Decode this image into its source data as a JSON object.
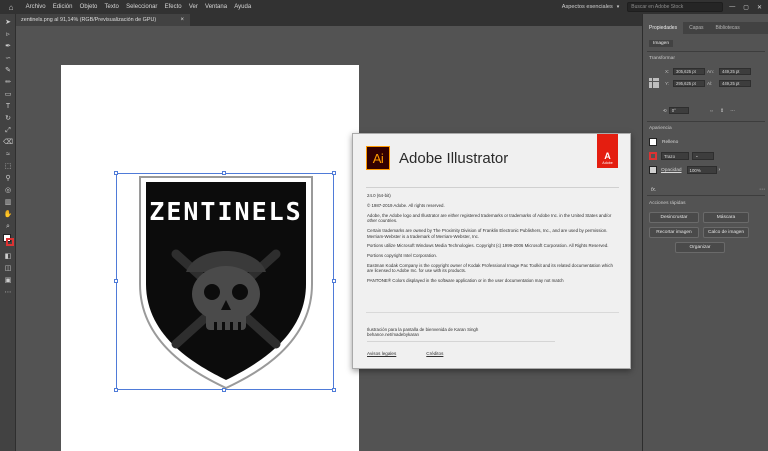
{
  "menubar": {
    "items": [
      "Archivo",
      "Edición",
      "Objeto",
      "Texto",
      "Seleccionar",
      "Efecto",
      "Ver",
      "Ventana",
      "Ayuda"
    ],
    "workspace": "Aspectos esenciales",
    "stock_search_placeholder": "Buscar en Adobe Stock",
    "window_controls": [
      "—",
      "▢",
      "✕"
    ]
  },
  "document_tab": {
    "title": "zentinels.png al 91,14% (RGB/Previsualización de GPU)",
    "close": "×"
  },
  "artwork": {
    "text": "ZENTINELS"
  },
  "about": {
    "logo": "Ai",
    "product_name": "Adobe Illustrator",
    "adobe_badge": {
      "letter": "A",
      "label": "Adobe"
    },
    "version": "24.0 (64-bit)",
    "copyright": "© 1987-2019 Adobe. All rights reserved.",
    "p1": "Adobe, the Adobe logo and Illustrator are either registered trademarks or trademarks of Adobe Inc. in the United States and/or other countries.",
    "p2": "Certain trademarks are owned by The Proximity Division of Franklin Electronic Publishers, Inc., and are used by permission. Merriam-Webster is a trademark of Merriam-Webster, Inc.",
    "p3": "Portions utilize Microsoft Windows Media Technologies. Copyright (c) 1999-2006 Microsoft Corporation. All Rights Reserved.",
    "p4": "Portions copyright Intel Corporation.",
    "p5": "Eastman Kodak Company is the copyright owner of Kodak Professional Image Pac Toolkit and its related documentation which are licensed to Adobe Inc. for use with its products.",
    "p6": "PANTONE® Colors displayed in the software application or in the user documentation may not match",
    "credit_line1": "Ilustración para la pantalla de bienvenida de Karan Singh",
    "credit_line2": "behance.net/madebykaran",
    "link_legal": "Avisos legales",
    "link_credits": "Créditos"
  },
  "panel": {
    "tabs": [
      "Propiedades",
      "Capas",
      "Bibliotecas"
    ],
    "context": "Imagen",
    "transform": {
      "title": "Transformar",
      "x_label": "X:",
      "x_value": "305,625 pt",
      "y_label": "Y:",
      "y_value": "295,625 pt",
      "w_label": "An:",
      "w_value": "449,25 pt",
      "h_label": "Al:",
      "h_value": "449,25 pt",
      "rotation": "0°"
    },
    "appearance": {
      "title": "Apariencia",
      "fill_label": "Relleno",
      "stroke_label": "Trazo",
      "opacity_label": "Opacidad",
      "opacity_value": "100%",
      "fx": "fx."
    },
    "quick_actions": {
      "title": "Acciones rápidas",
      "btn_desincrustar": "Desincrustar",
      "btn_mascara": "Máscara",
      "btn_recortar": "Recortar imagen",
      "btn_calco": "Calco de imagen",
      "btn_organizar": "Organizar"
    }
  },
  "colors": {
    "ui_dark": "#323232",
    "ui_mid": "#535353",
    "ai_orange": "#ff9a00",
    "adobe_red": "#e41e10",
    "selection_blue": "#4f7bd8"
  }
}
